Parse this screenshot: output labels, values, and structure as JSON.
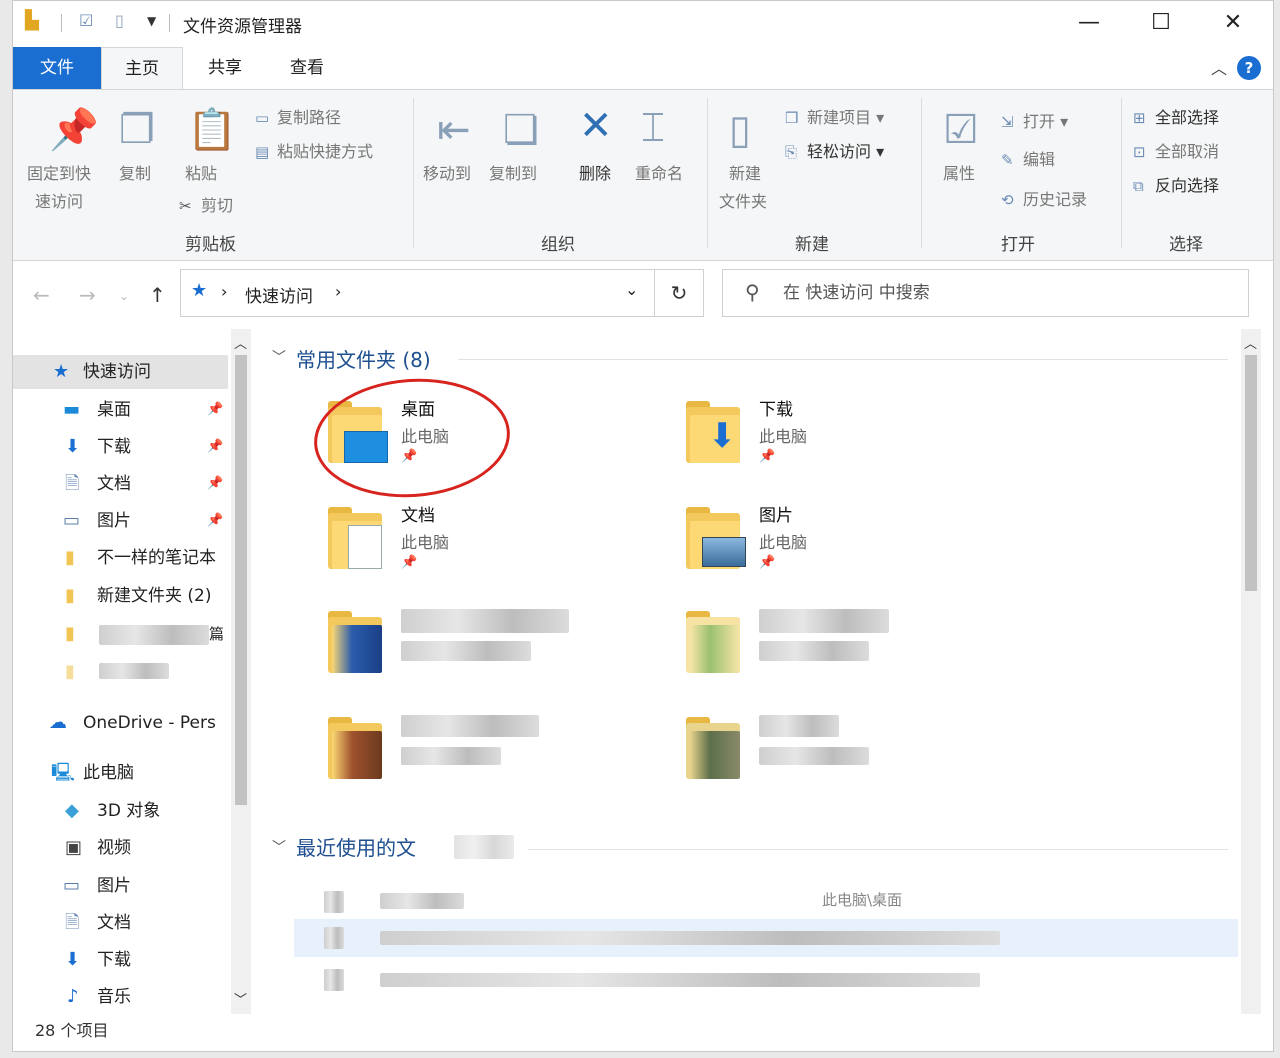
{
  "window": {
    "title": "文件资源管理器",
    "controls": [
      "—",
      "☐",
      "✕"
    ]
  },
  "tabs": {
    "file": "文件",
    "home": "主页",
    "share": "共享",
    "view": "查看"
  },
  "ribbon": {
    "clipboard": {
      "pin": "固定到快\n速访问",
      "pin_l1": "固定到快",
      "pin_l2": "速访问",
      "copy": "复制",
      "paste": "粘贴",
      "copy_path": "复制路径",
      "paste_shortcut": "粘贴快捷方式",
      "cut": "剪切",
      "label": "剪贴板"
    },
    "organize": {
      "move_to": "移动到",
      "copy_to": "复制到",
      "delete": "删除",
      "rename": "重命名",
      "label": "组织"
    },
    "new": {
      "new_folder_l1": "新建",
      "new_folder_l2": "文件夹",
      "new_item": "新建项目",
      "easy_access": "轻松访问",
      "label": "新建"
    },
    "open": {
      "properties": "属性",
      "open": "打开",
      "edit": "编辑",
      "history": "历史记录",
      "label": "打开"
    },
    "select": {
      "select_all": "全部选择",
      "select_none": "全部取消",
      "invert": "反向选择",
      "label": "选择"
    }
  },
  "address": {
    "path": "快速访问",
    "sep": "›"
  },
  "search": {
    "placeholder": "在 快速访问 中搜索"
  },
  "nav": {
    "quick_access": "快速访问",
    "pinned": [
      {
        "label": "桌面"
      },
      {
        "label": "下载"
      },
      {
        "label": "文档"
      },
      {
        "label": "图片"
      }
    ],
    "folders": [
      {
        "label": "不一样的笔记本"
      },
      {
        "label": "新建文件夹 (2)"
      }
    ],
    "partial_label": "篇",
    "onedrive": "OneDrive - Pers",
    "this_pc": "此电脑",
    "pc_items": [
      {
        "label": "3D 对象"
      },
      {
        "label": "视频"
      },
      {
        "label": "图片"
      },
      {
        "label": "文档"
      },
      {
        "label": "下载"
      },
      {
        "label": "音乐"
      }
    ]
  },
  "frequent": {
    "header": "常用文件夹 (8)",
    "tiles": [
      {
        "name": "桌面",
        "location": "此电脑"
      },
      {
        "name": "下载",
        "location": "此电脑"
      },
      {
        "name": "文档",
        "location": "此电脑"
      },
      {
        "name": "图片",
        "location": "此电脑"
      }
    ]
  },
  "recent": {
    "header": "最近使用的文",
    "path_hint": "此电脑\\桌面"
  },
  "status": {
    "count": "28 个项目"
  },
  "colors": {
    "accent": "#1a6dd1",
    "annotation": "#d7241f",
    "folder": "#fcd975"
  }
}
